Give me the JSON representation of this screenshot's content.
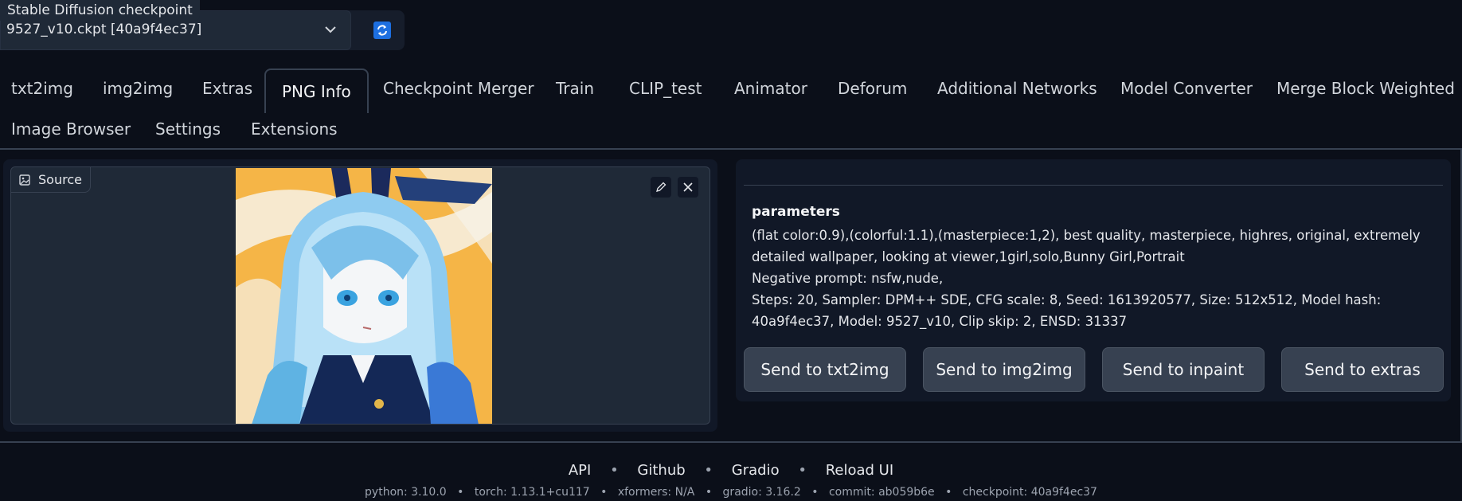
{
  "checkpoint": {
    "label": "Stable Diffusion checkpoint",
    "value": "9527_v10.ckpt [40a9f4ec37]"
  },
  "tabs": [
    {
      "label": "txt2img"
    },
    {
      "label": "img2img"
    },
    {
      "label": "Extras"
    },
    {
      "label": "PNG Info",
      "active": true
    },
    {
      "label": "Checkpoint Merger"
    },
    {
      "label": "Train"
    },
    {
      "label": "CLIP_test"
    },
    {
      "label": "Animator"
    },
    {
      "label": "Deforum"
    },
    {
      "label": "Additional Networks"
    },
    {
      "label": "Model Converter"
    },
    {
      "label": "Merge Block Weighted"
    },
    {
      "label": "Image Browser"
    },
    {
      "label": "Settings"
    },
    {
      "label": "Extensions"
    }
  ],
  "source": {
    "label": "Source"
  },
  "output": {
    "title": "parameters",
    "line1": "(flat color:0.9),(colorful:1.1),(masterpiece:1,2), best quality, masterpiece, highres, original, extremely detailed wallpaper, looking at viewer,1girl,solo,Bunny Girl,Portrait",
    "line2": "Negative prompt: nsfw,nude,",
    "line3": "Steps: 20, Sampler: DPM++ SDE, CFG scale: 8, Seed: 1613920577, Size: 512x512, Model hash: 40a9f4ec37, Model: 9527_v10, Clip skip: 2, ENSD: 31337"
  },
  "buttons": {
    "send_txt2img": "Send to txt2img",
    "send_img2img": "Send to img2img",
    "send_inpaint": "Send to inpaint",
    "send_extras": "Send to extras"
  },
  "footer": {
    "links": [
      "API",
      "Github",
      "Gradio",
      "Reload UI"
    ],
    "separator": "•",
    "info": [
      "python: 3.10.0",
      "torch: 1.13.1+cu117",
      "xformers: N/A",
      "gradio: 3.16.2",
      "commit: ab059b6e",
      "checkpoint: 40a9f4ec37"
    ]
  },
  "colors": {
    "background": "#0b0f19",
    "panel": "#111827",
    "button": "#374151",
    "refresh_accent": "#1d6fe0",
    "image_bg": "#f5b547",
    "image_hair": "#8ecbf0"
  },
  "icons": [
    "chevron-down-icon",
    "refresh-icon",
    "image-icon",
    "edit-icon",
    "close-icon"
  ]
}
